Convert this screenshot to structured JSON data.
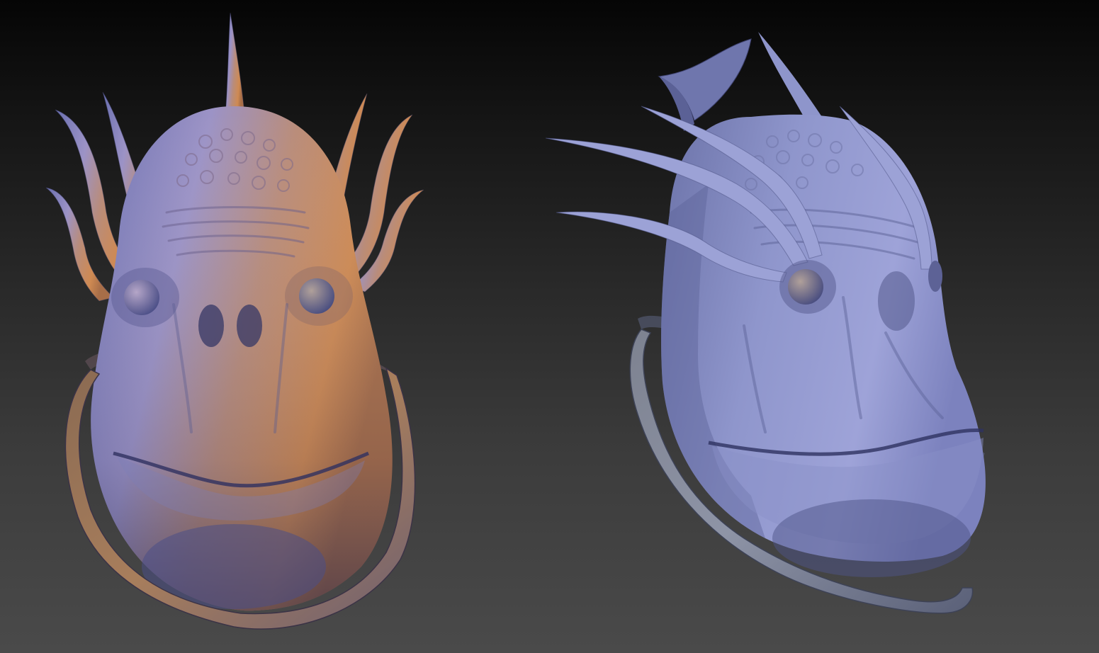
{
  "scene": {
    "subjects": [
      {
        "view": "front"
      },
      {
        "view": "three-quarter"
      }
    ],
    "colors": {
      "background_top": "#050505",
      "background_bottom": "#4a4a4a",
      "clay_lit": "#c98a58",
      "clay_mid": "#9a92c8",
      "clay_shadow": "#5f64a0",
      "clay_dark": "#3f4478"
    }
  }
}
